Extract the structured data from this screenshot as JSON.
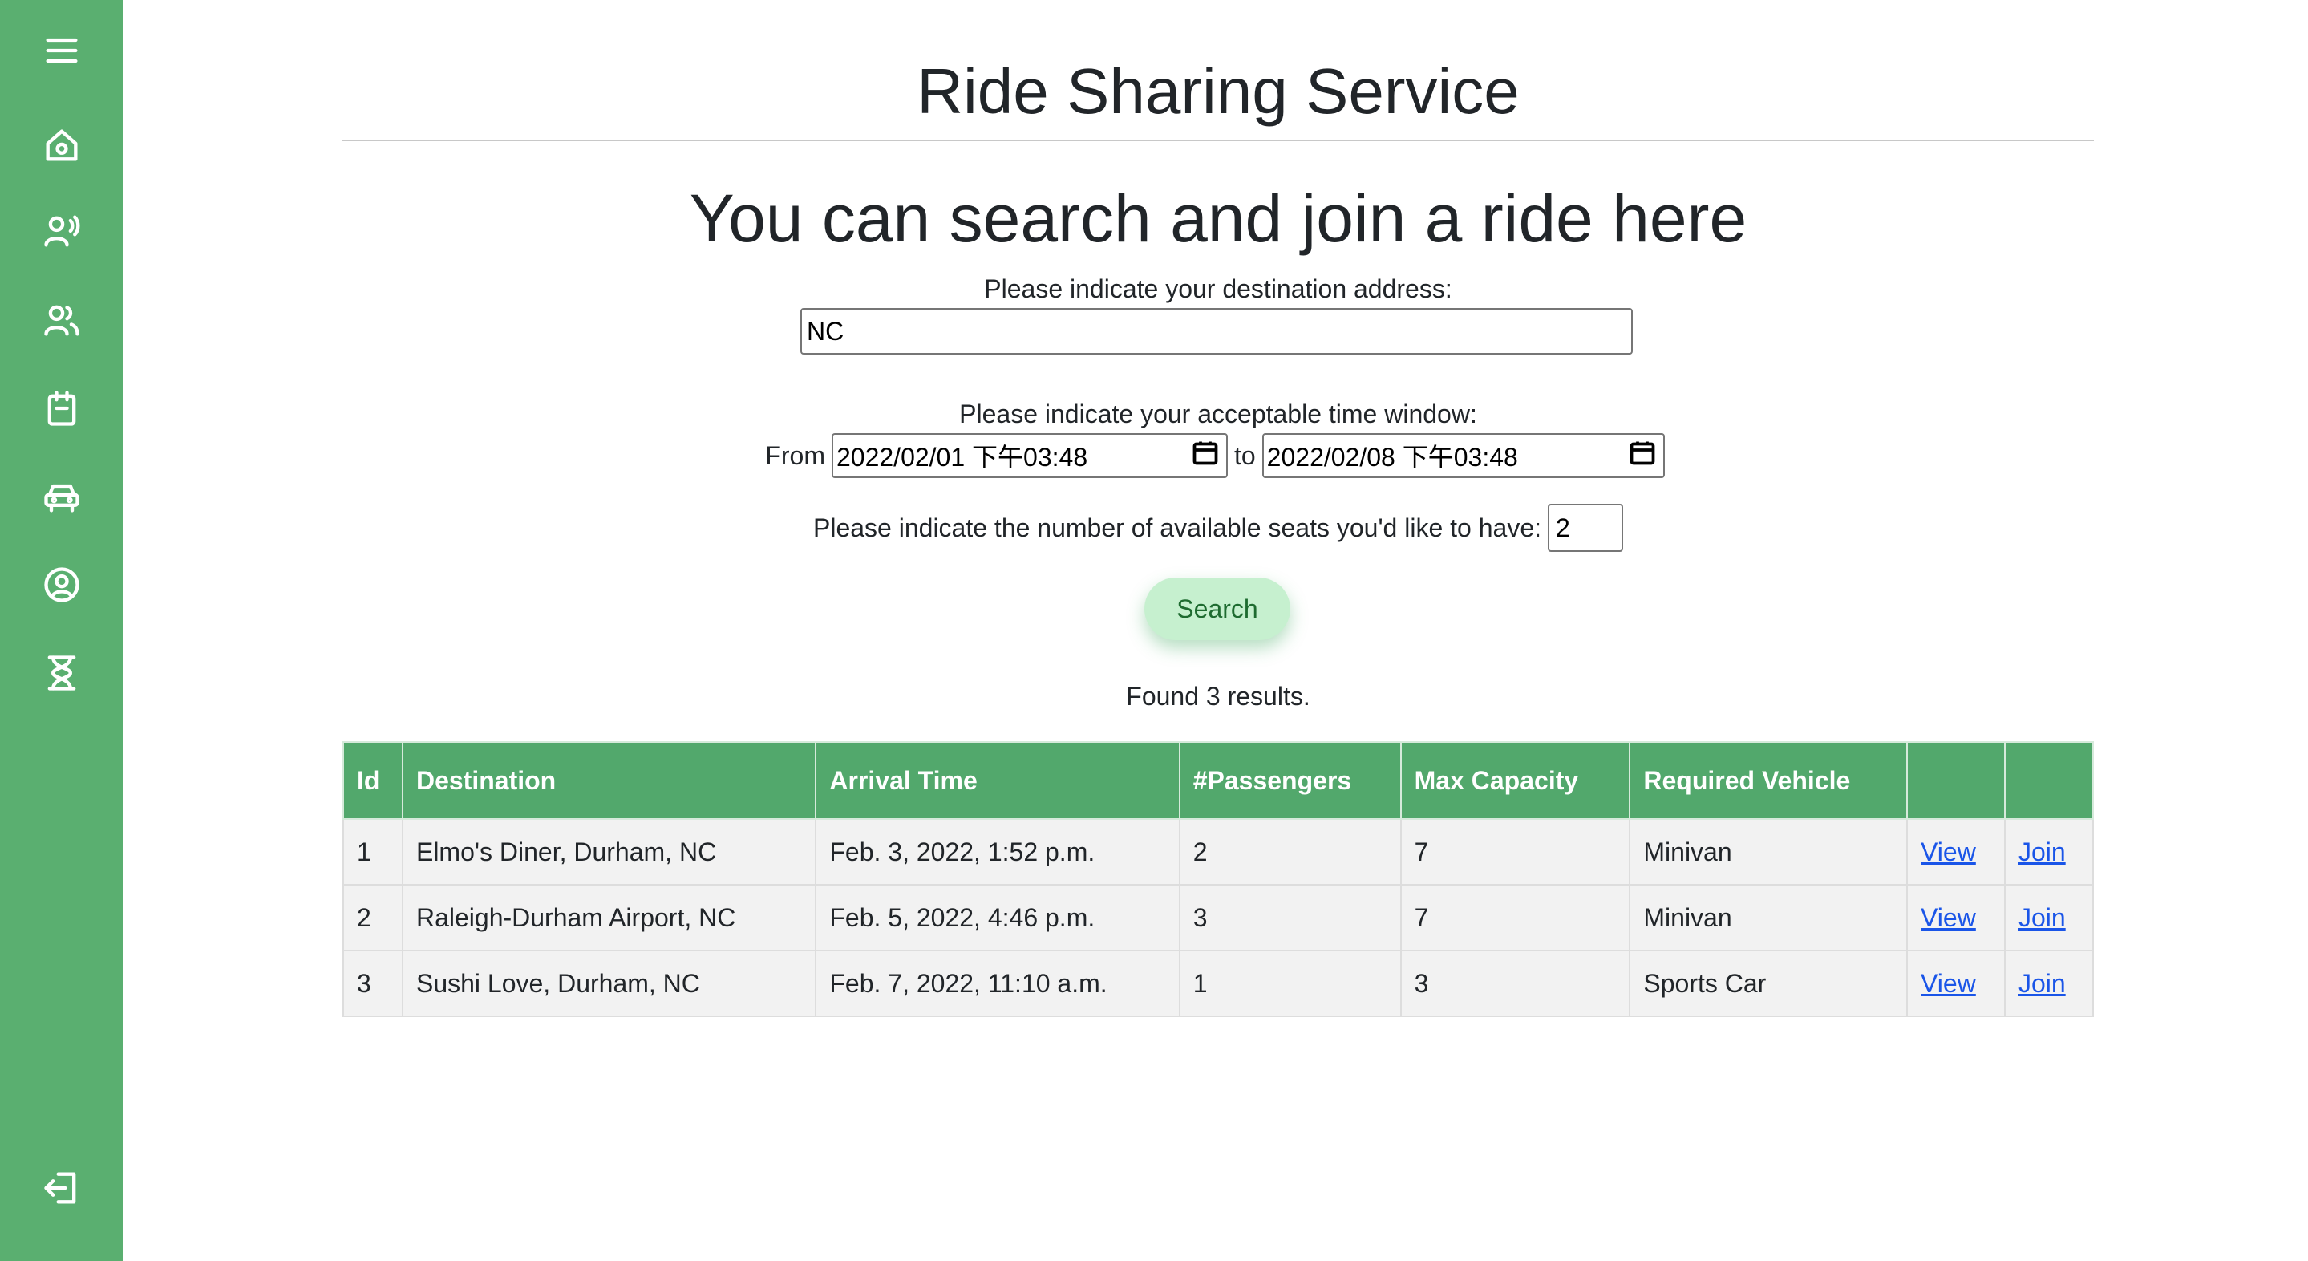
{
  "app": {
    "title": "Ride Sharing Service",
    "subtitle": "You can search and join a ride here"
  },
  "sidebar": {
    "items": [
      {
        "icon": "menu-icon"
      },
      {
        "icon": "home-icon"
      },
      {
        "icon": "broadcast-user-icon"
      },
      {
        "icon": "users-icon"
      },
      {
        "icon": "clipboard-icon"
      },
      {
        "icon": "car-icon"
      },
      {
        "icon": "user-circle-icon"
      },
      {
        "icon": "hourglass-icon"
      },
      {
        "icon": "logout-icon"
      }
    ],
    "color": "#5aaf70"
  },
  "search": {
    "destination_label": "Please indicate your destination address:",
    "destination_value": "NC",
    "time_window_label": "Please indicate your acceptable time window:",
    "from_label": "From",
    "from_value": "2022/02/01 下午03:48",
    "to_label": "to",
    "to_value": "2022/02/08 下午03:48",
    "seats_label": "Please indicate the number of available seats you'd like to have:",
    "seats_value": "2",
    "button_label": "Search"
  },
  "results": {
    "summary": "Found 3 results.",
    "columns": [
      "Id",
      "Destination",
      "Arrival Time",
      "#Passengers",
      "Max Capacity",
      "Required Vehicle",
      "",
      ""
    ],
    "rows": [
      {
        "id": "1",
        "destination": "Elmo's Diner, Durham, NC",
        "arrival": "Feb. 3, 2022, 1:52 p.m.",
        "passengers": "2",
        "capacity": "7",
        "vehicle": "Minivan",
        "view": "View",
        "join": "Join"
      },
      {
        "id": "2",
        "destination": "Raleigh-Durham Airport, NC",
        "arrival": "Feb. 5, 2022, 4:46 p.m.",
        "passengers": "3",
        "capacity": "7",
        "vehicle": "Minivan",
        "view": "View",
        "join": "Join"
      },
      {
        "id": "3",
        "destination": "Sushi Love, Durham, NC",
        "arrival": "Feb. 7, 2022, 11:10 a.m.",
        "passengers": "1",
        "capacity": "3",
        "vehicle": "Sports Car",
        "view": "View",
        "join": "Join"
      }
    ],
    "header_color": "#52a86c"
  }
}
